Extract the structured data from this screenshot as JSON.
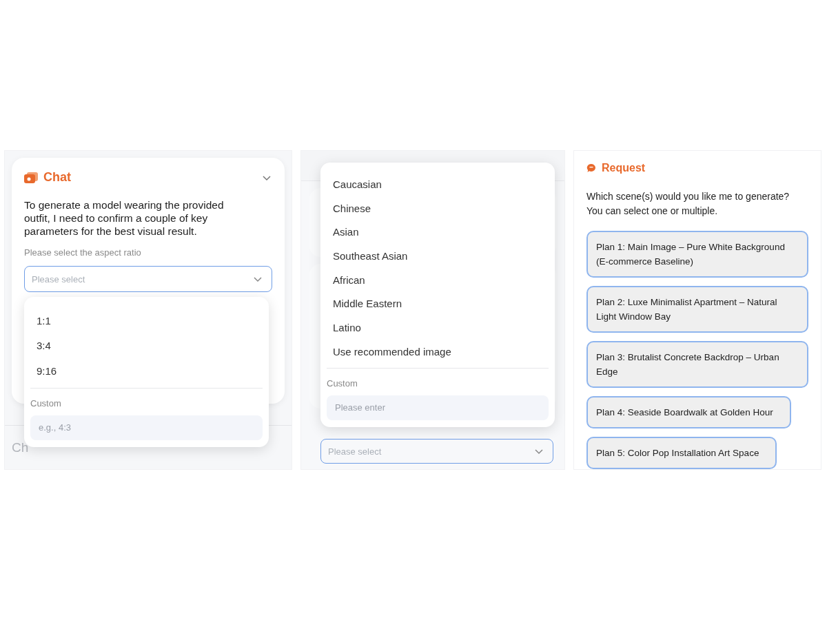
{
  "panels": [
    {
      "kind": "chat",
      "title": "Chat",
      "message": "To generate a model wearing the provided outfit, I need to confirm a couple of key parameters for the best visual result.",
      "field_label": "Please select the aspect ratio",
      "select_placeholder": "Please select",
      "options": [
        {
          "label": "1:1"
        },
        {
          "label": "3:4"
        },
        {
          "label": "9:16"
        }
      ],
      "custom_label": "Custom",
      "custom_placeholder": "e.g., 4:3",
      "input_text": "Ch"
    },
    {
      "kind": "picker",
      "options": [
        {
          "label": "Caucasian"
        },
        {
          "label": "Chinese"
        },
        {
          "label": "Asian"
        },
        {
          "label": "Southeast Asian"
        },
        {
          "label": "African"
        },
        {
          "label": "Middle Eastern"
        },
        {
          "label": "Latino"
        },
        {
          "label": "Use recommended image"
        }
      ],
      "custom_label": "Custom",
      "custom_placeholder": "Please enter",
      "select_placeholder": "Please select"
    },
    {
      "kind": "request",
      "title": "Request",
      "question": "Which scene(s) would you like me to generate? You can select one or multiple.",
      "plans": [
        {
          "label": "Plan 1: Main Image – Pure White Background (E-commerce Baseline)"
        },
        {
          "label": "Plan 2: Luxe Minimalist Apartment – Natural Light Window Bay"
        },
        {
          "label": "Plan 3: Brutalist Concrete Backdrop – Urban Edge"
        },
        {
          "label": "Plan 4: Seaside Boardwalk at Golden Hour"
        },
        {
          "label": "Plan 5: Color Pop Installation Art Space"
        }
      ]
    }
  ]
}
